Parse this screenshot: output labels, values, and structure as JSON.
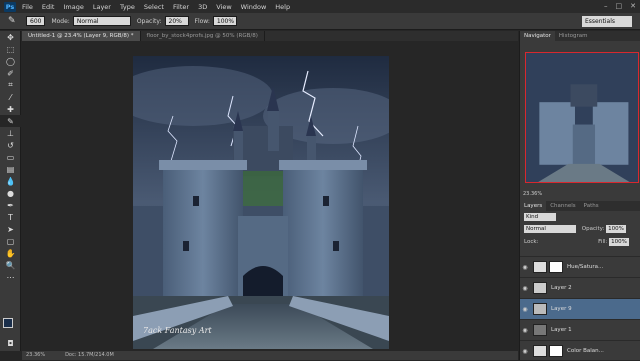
{
  "app": {
    "logo": "Ps",
    "menu": [
      "File",
      "Edit",
      "Image",
      "Layer",
      "Type",
      "Select",
      "Filter",
      "3D",
      "View",
      "Window",
      "Help"
    ]
  },
  "options": {
    "size": "600",
    "mode_label": "Mode:",
    "mode_value": "Normal",
    "opacity_label": "Opacity:",
    "opacity_value": "20%",
    "flow_label": "Flow:",
    "flow_value": "100%",
    "workspace": "Essentials"
  },
  "tabs": [
    {
      "label": "Untitled-1 @ 23.4% (Layer 9, RGB/8) *"
    },
    {
      "label": "floor_by_stock4profs.jpg @ 50% (RGB/8)"
    }
  ],
  "watermark": "7ack Fantasy Art",
  "status": {
    "zoom": "23.36%",
    "doc": "Doc: 15.7M/214.0M"
  },
  "panels": {
    "nav_tab": "Navigator",
    "hist_tab": "Histogram",
    "nav_zoom": "23.36%",
    "layers_tab": "Layers",
    "channels_tab": "Channels",
    "paths_tab": "Paths",
    "kind": "Kind",
    "blend": "Normal",
    "opacity_label": "Opacity:",
    "opacity_value": "100%",
    "lock_label": "Lock:",
    "fill_label": "Fill:",
    "fill_value": "100%",
    "layers": [
      {
        "name": "Hue/Satura..."
      },
      {
        "name": "Layer 2"
      },
      {
        "name": "Layer 9"
      },
      {
        "name": "Layer 1"
      },
      {
        "name": "Color Balan..."
      }
    ]
  }
}
